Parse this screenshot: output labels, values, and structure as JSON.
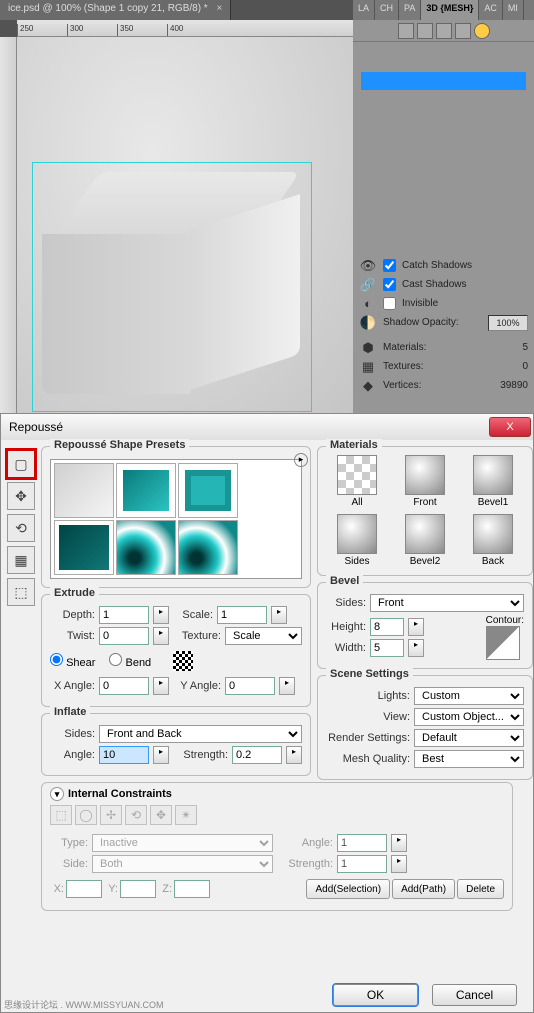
{
  "doc_tab": "ice.psd @ 100% (Shape 1 copy 21, RGB/8) *",
  "ruler_marks": [
    "250",
    "300",
    "350",
    "400"
  ],
  "panel_tabs": [
    "LA",
    "CH",
    "PA",
    "3D {MESH}",
    "AC",
    "MI"
  ],
  "panel_rows": {
    "catch_shadows": "Catch Shadows",
    "cast_shadows": "Cast Shadows",
    "invisible": "Invisible",
    "shadow_opacity_label": "Shadow Opacity:",
    "shadow_opacity_val": "100%",
    "materials_label": "Materials:",
    "materials_val": "5",
    "textures_label": "Textures:",
    "textures_val": "0",
    "vertices_label": "Vertices:",
    "vertices_val": "39890"
  },
  "dialog": {
    "title": "Repoussé",
    "close": "X",
    "presets_title": "Repoussé Shape Presets",
    "extrude": {
      "title": "Extrude",
      "depth_label": "Depth:",
      "depth": "1",
      "scale_label": "Scale:",
      "scale": "1",
      "twist_label": "Twist:",
      "twist": "0",
      "texture_label": "Texture:",
      "texture": "Scale",
      "shear": "Shear",
      "bend": "Bend",
      "xangle_label": "X Angle:",
      "xangle": "0",
      "yangle_label": "Y Angle:",
      "yangle": "0"
    },
    "inflate": {
      "title": "Inflate",
      "sides_label": "Sides:",
      "sides": "Front and Back",
      "angle_label": "Angle:",
      "angle": "10",
      "strength_label": "Strength:",
      "strength": "0.2"
    },
    "materials": {
      "title": "Materials",
      "items": [
        "All",
        "Front",
        "Bevel1",
        "Sides",
        "Bevel2",
        "Back"
      ]
    },
    "bevel": {
      "title": "Bevel",
      "sides_label": "Sides:",
      "sides": "Front",
      "height_label": "Height:",
      "height": "8",
      "width_label": "Width:",
      "width": "5",
      "contour_label": "Contour:"
    },
    "scene": {
      "title": "Scene Settings",
      "lights_label": "Lights:",
      "lights": "Custom",
      "view_label": "View:",
      "view": "Custom Object...",
      "render_label": "Render Settings:",
      "render": "Default",
      "mesh_label": "Mesh Quality:",
      "mesh": "Best"
    },
    "internal": {
      "title": "Internal Constraints",
      "type_label": "Type:",
      "type": "Inactive",
      "side_label": "Side:",
      "side": "Both",
      "angle_label": "Angle:",
      "angle": "1",
      "strength_label": "Strength:",
      "strength": "1",
      "x_label": "X:",
      "y_label": "Y:",
      "z_label": "Z:",
      "add_sel": "Add(Selection)",
      "add_path": "Add(Path)",
      "delete": "Delete"
    },
    "ok": "OK",
    "cancel": "Cancel"
  },
  "watermark": "思缘设计论坛 . WWW.MISSYUAN.COM"
}
